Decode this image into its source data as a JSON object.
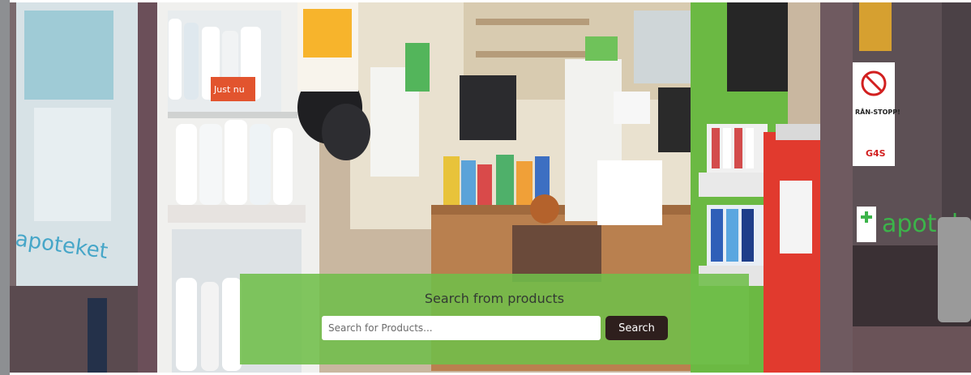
{
  "hero": {
    "image_name": "pharmacy-storefront-photo",
    "sign_brand_text": "apotek",
    "sign_window_text": "apoteket",
    "poster_title": "RÅN-STOPP!",
    "poster_logo": "G4S",
    "shelf_label": "Just nu"
  },
  "search": {
    "title": "Search from products",
    "placeholder": "Search for Products...",
    "button_label": "Search"
  },
  "colors": {
    "panel": "#70be4a",
    "button": "#2e1f1d",
    "frame": "#6f5a60",
    "brand_green": "#3cb44a"
  },
  "icons": [
    "pharmacy-cross-icon",
    "no-weapon-icon"
  ]
}
